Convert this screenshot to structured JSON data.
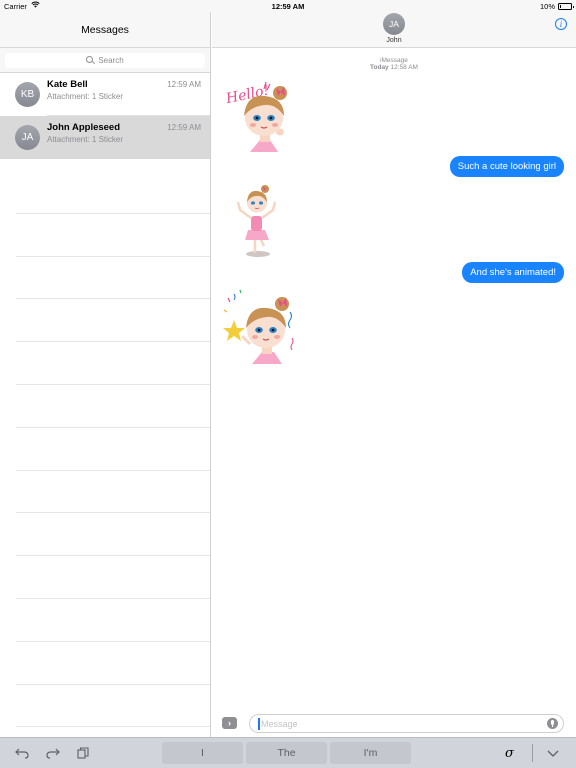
{
  "status_bar": {
    "carrier": "Carrier",
    "time": "12:59 AM",
    "battery": "10%",
    "battery_level": 0.1
  },
  "sidebar": {
    "title": "Messages",
    "search_placeholder": "Search",
    "conversations": [
      {
        "initials": "KB",
        "name": "Kate Bell",
        "time": "12:59 AM",
        "preview": "Attachment: 1 Sticker",
        "selected": false
      },
      {
        "initials": "JA",
        "name": "John Appleseed",
        "time": "12:59 AM",
        "preview": "Attachment: 1 Sticker",
        "selected": true
      }
    ]
  },
  "conversation": {
    "contact_initials": "JA",
    "contact_name": "John",
    "service": "iMessage",
    "date_label": "Today",
    "date_time": "12:58 AM",
    "stickers": [
      {
        "text": "Hello!"
      },
      {
        "text": ""
      },
      {
        "text": ""
      }
    ],
    "messages": [
      {
        "text": "Such a cute looking girl",
        "sender": "me"
      },
      {
        "text": "And she's animated!",
        "sender": "me"
      }
    ],
    "input_placeholder": "Message"
  },
  "keyboard": {
    "suggestions": [
      "I",
      "The",
      "I'm"
    ]
  },
  "colors": {
    "bubble_blue": "#1a84ff",
    "accent_blue": "#1a7cf5",
    "sticker_pink": "#e94d8b"
  }
}
